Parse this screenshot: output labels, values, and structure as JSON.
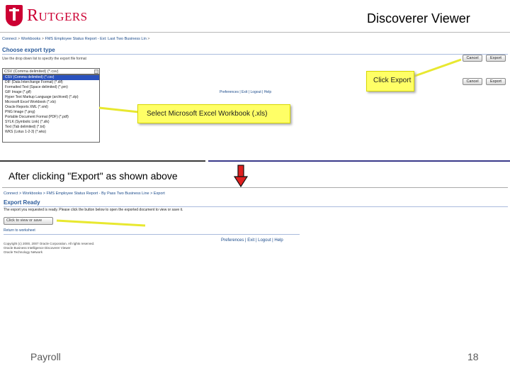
{
  "header": {
    "logo_text": "Rutgers",
    "title": "Discoverer Viewer"
  },
  "top": {
    "breadcrumb": [
      "Connect",
      "Workbooks",
      "FMS Employee Status Report - Ext: Last Two Business Lin"
    ],
    "page_title": "Choose export type",
    "instruction": "Use the drop down list to specify the export file format",
    "selected_value": "CSV (Comma delimited) (*.csv)",
    "options": [
      "CSV (Comma delimited) (*.csv)",
      "DIF (Data Interchange Format) (*.dif)",
      "Formatted Text (Space delimited) (*.prn)",
      "GIF Image (*.gif)",
      "Hyper Text Markup Language (archived) (*.zip)",
      "Microsoft Excel Workbook (*.xls)",
      "Oracle Reports XML (*.xml)",
      "PNG Image (*.png)",
      "Portable Document Format (PDF) (*.pdf)",
      "SYLK (Symbolic Link) (*.slk)",
      "Text (Tab delimited) (*.txt)",
      "WKS (Lotus 1-2-3) (*.wks)"
    ],
    "cancel_label": "Cancel",
    "export_label": "Export",
    "links": "Preferences | Exit | Logout | Help",
    "callout_export": "Click Export",
    "callout_excel": "Select Microsoft Excel Workbook (.xls)"
  },
  "middle": {
    "after_text": "After clicking \"Export\" as shown above"
  },
  "bottom": {
    "breadcrumb": [
      "Connect",
      "Workbooks",
      "FMS Employee Status Report - By Pass Two Business Line",
      "Export"
    ],
    "page_title": "Export Ready",
    "message": "The export you requested is ready. Please click the button below to open the exported document to view or save it.",
    "open_button": "Click to view or save",
    "return_link": "Return to worksheet",
    "links": "Preferences | Exit | Logout | Help",
    "copyright": "Copyright (c) 2000, 2007 Oracle Corporation. All rights reserved.\nOracle Business Intelligence Discoverer Viewer\nOracle Technology Network"
  },
  "footer": {
    "left": "Payroll",
    "page_number": "18"
  },
  "colors": {
    "brand_red": "#cc0033",
    "callout_yellow": "#ffff66",
    "arrow_red": "#e02020",
    "selection_blue": "#2a52be"
  }
}
